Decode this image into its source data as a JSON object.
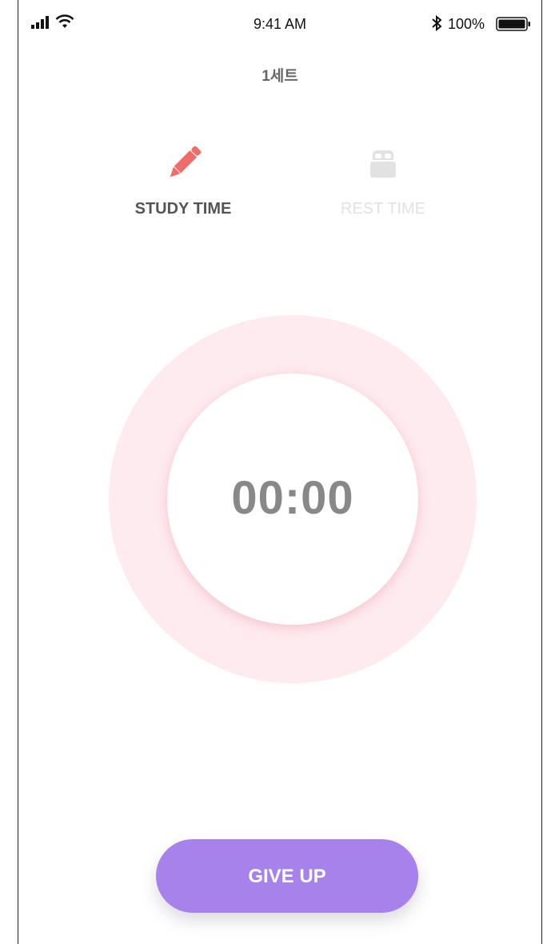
{
  "status_bar": {
    "time": "9:41 AM",
    "battery": "100%",
    "icons": [
      "signal-icon",
      "wifi-icon",
      "bluetooth-icon",
      "battery-icon"
    ]
  },
  "header": {
    "title": "1세트"
  },
  "modes": [
    {
      "label": "STUDY TIME",
      "icon": "pencil-icon",
      "active": true,
      "color": "#f26b6b"
    },
    {
      "label": "REST TIME",
      "icon": "bed-icon",
      "active": false,
      "color": "#e2e2e2"
    }
  ],
  "timer": {
    "display": "00:00",
    "ring_color": "#fdebf0"
  },
  "actions": {
    "give_up_label": "GIVE UP",
    "button_color": "#a782ea"
  }
}
